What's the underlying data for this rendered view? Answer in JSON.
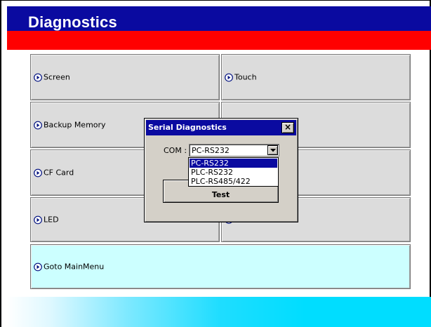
{
  "header": {
    "title": "Diagnostics"
  },
  "menu": {
    "tiles": [
      {
        "label": "Screen"
      },
      {
        "label": "Touch"
      },
      {
        "label": "Backup Memory"
      },
      {
        "label": ""
      },
      {
        "label": "CF Card"
      },
      {
        "label": ""
      },
      {
        "label": "LED"
      },
      {
        "label": ""
      }
    ],
    "main_menu_label": "Goto MainMenu"
  },
  "dialog": {
    "title": "Serial Diagnostics",
    "close_glyph": "×",
    "com_label": "COM :",
    "com_selected": "PC-RS232",
    "com_options": [
      "PC-RS232",
      "PLC-RS232",
      "PLC-RS485/422"
    ],
    "test_button": "Test"
  },
  "colors": {
    "title_bar": "#0a0aa0",
    "red_bar": "#ff0000",
    "tile": "#dcdcdc",
    "main_menu_tile": "#ccffff",
    "gradient_end": "#00ddff",
    "dialog_face": "#d4d0c8"
  },
  "icons": {
    "tile_icon": "circle-arrow-right-icon",
    "combo_icon": "chevron-down-icon"
  }
}
